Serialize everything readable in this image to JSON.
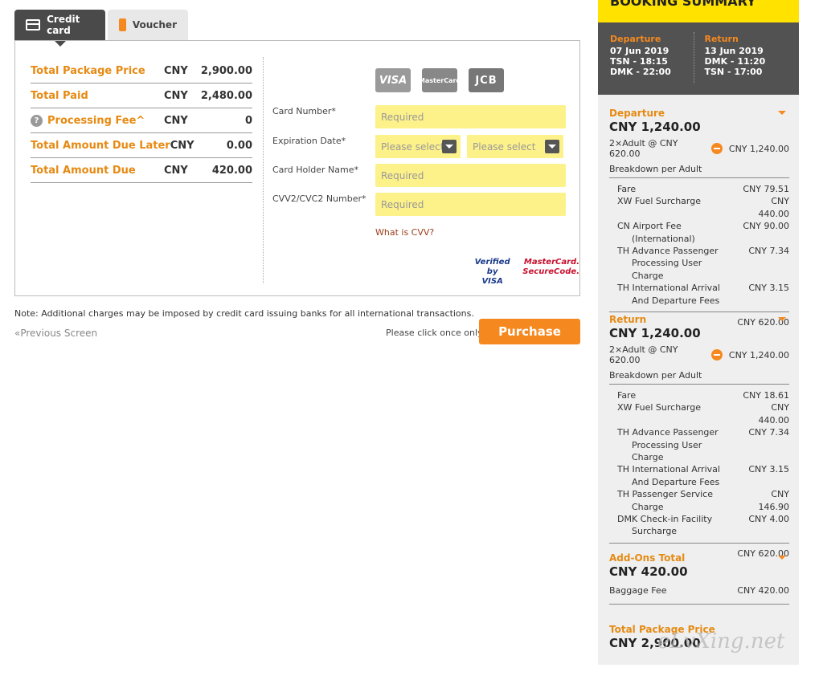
{
  "tabs": {
    "credit": "Credit card",
    "voucher": "Voucher"
  },
  "prices": [
    {
      "label": "Total Package Price",
      "cur": "CNY",
      "amt": "2,900.00"
    },
    {
      "label": "Total Paid",
      "cur": "CNY",
      "amt": "2,480.00"
    },
    {
      "label": "Processing Fee^",
      "cur": "CNY",
      "amt": "0"
    },
    {
      "label": "Total Amount Due Later",
      "cur": "CNY",
      "amt": "0.00"
    },
    {
      "label": "Total Amount Due",
      "cur": "CNY",
      "amt": "420.00"
    }
  ],
  "card_logos": {
    "visa": "VISA",
    "mc": "MasterCard",
    "jcb": "JCB"
  },
  "form": {
    "card_number": "Card Number*",
    "expiration": "Expiration Date*",
    "holder": "Card Holder Name*",
    "cvv": "CVV2/CVC2 Number*",
    "required": "Required",
    "please_select": "Please select",
    "what_cvv": "What is CVV?",
    "verified1": "Verified by",
    "verified2": "VISA",
    "msc1": "MasterCard.",
    "msc2": "SecureCode."
  },
  "note": "Note: Additional charges may be imposed by credit card issuing banks for all international transactions.",
  "prev": "«Previous Screen",
  "click_once": "Please click once only",
  "purchase": "Purchase",
  "summary": {
    "title": "BOOKING SUMMARY",
    "dep_title": "Departure",
    "dep_date": "07 Jun 2019",
    "dep_l1": "TSN - 18:15",
    "dep_l2": "DMK - 22:00",
    "ret_title": "Return",
    "ret_date": "13 Jun 2019",
    "ret_l1": "DMK - 11:20",
    "ret_l2": "TSN - 17:00",
    "departure": {
      "title": "Departure",
      "amount": "CNY 1,240.00",
      "adult": "2×Adult @  CNY 620.00",
      "adult_total": "CNY 1,240.00",
      "breakdown": "Breakdown per Adult",
      "subtotal": "CNY 620.00"
    },
    "return": {
      "title": "Return",
      "amount": "CNY 1,240.00",
      "adult": "2×Adult @  CNY 620.00",
      "adult_total": "CNY 1,240.00",
      "breakdown": "Breakdown per Adult",
      "subtotal": "CNY 620.00"
    },
    "addons": {
      "title": "Add-Ons Total",
      "amount": "CNY 420.00",
      "baggage": "Baggage Fee",
      "baggage_amt": "CNY 420.00"
    },
    "total": {
      "title": "Total Package Price",
      "amount": "CNY 2,900.00"
    }
  },
  "dep_items": [
    {
      "n1": "Fare",
      "n2": "",
      "n3": "",
      "v": "CNY 79.51"
    },
    {
      "n1": "XW Fuel Surcharge",
      "n2": "",
      "n3": "",
      "v": "CNY 440.00"
    },
    {
      "n1": "CN Airport Fee",
      "n2": "(International)",
      "n3": "",
      "v": "CNY 90.00"
    },
    {
      "n1": "TH Advance Passenger",
      "n2": "Processing User",
      "n3": "Charge",
      "v": "CNY 7.34"
    },
    {
      "n1": "TH International Arrival",
      "n2": "And Departure Fees",
      "n3": "",
      "v": "CNY 3.15"
    }
  ],
  "ret_items": [
    {
      "n1": "Fare",
      "n2": "",
      "n3": "",
      "v": "CNY 18.61"
    },
    {
      "n1": "XW Fuel Surcharge",
      "n2": "",
      "n3": "",
      "v": "CNY 440.00"
    },
    {
      "n1": "TH Advance Passenger",
      "n2": "Processing User",
      "n3": "Charge",
      "v": "CNY 7.34"
    },
    {
      "n1": "TH International Arrival",
      "n2": "And Departure Fees",
      "n3": "",
      "v": "CNY 3.15"
    },
    {
      "n1": "TH Passenger Service",
      "n2": "Charge",
      "n3": "",
      "v": "CNY 146.90"
    },
    {
      "n1": "DMK Check-in Facility",
      "n2": "Surcharge",
      "n3": "",
      "v": "CNY 4.00"
    }
  ],
  "watermark": "eLvXing.net",
  "accent": "#f5891f",
  "highlight": "#fdf18a"
}
